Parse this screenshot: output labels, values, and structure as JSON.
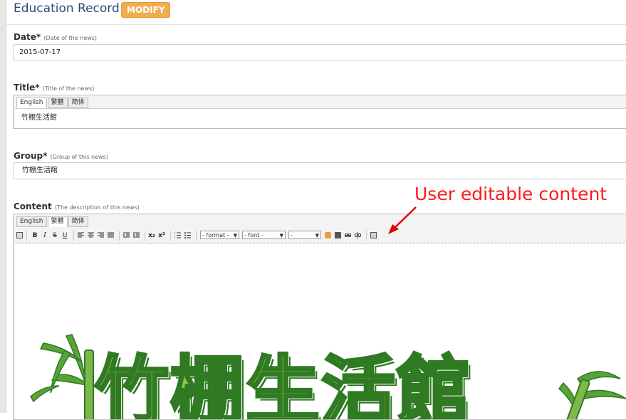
{
  "header": {
    "title": "Education Record",
    "badge": "MODIFY"
  },
  "date": {
    "label": "Date*",
    "hint": "(Date of the news)",
    "value": "2015-07-17"
  },
  "title_field": {
    "label": "Title*",
    "hint": "(Title of the news)",
    "tabs": [
      "English",
      "繁體",
      "简体"
    ],
    "active_tab": "English",
    "value": "竹棚生活館"
  },
  "group": {
    "label": "Group*",
    "hint": "(Group of this news)",
    "value": "竹棚生活館"
  },
  "content": {
    "label": "Content",
    "hint": "(The description of this news)",
    "tabs": [
      "English",
      "繁體",
      "简体"
    ],
    "active_tab": "繁體",
    "toolbar": {
      "bold": "B",
      "italic": "I",
      "strike": "S",
      "underline": "U",
      "subscript": "x₂",
      "superscript": "x²",
      "format_select": "- format -",
      "font_select": "- font -",
      "size_select": "-"
    },
    "banner_text": "竹棚生活館"
  },
  "annotation": {
    "text": "User editable content",
    "color": "#ff1a1a"
  },
  "colors": {
    "accent": "#f0ad4e",
    "title": "#2b4a7a",
    "bamboo": "#8ec63f"
  }
}
